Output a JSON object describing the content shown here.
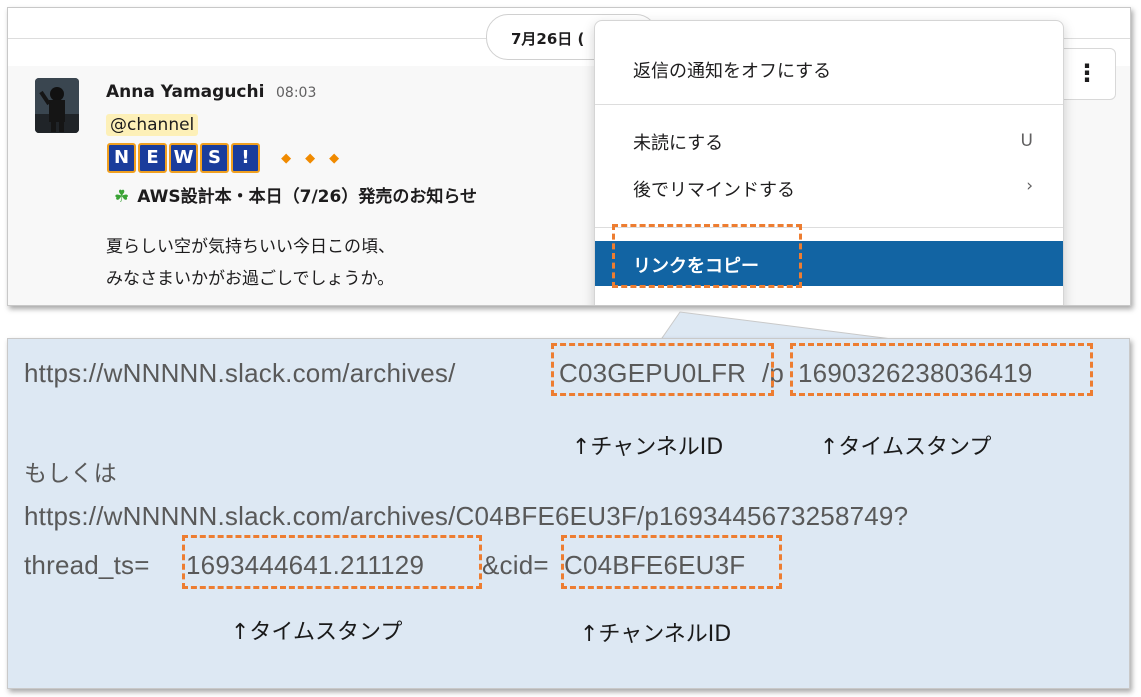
{
  "slack": {
    "date_label": "7月26日 (",
    "author": "Anna Yamaguchi",
    "time": "08:03",
    "mention": "@channel",
    "news_letters": [
      "N",
      "E",
      "W",
      "S",
      "!"
    ],
    "aws_title": "AWS設計本・本日（7/26）発売のお知らせ",
    "body_line1": "夏らしい空が気持ちいい今日この頃、",
    "body_line2": "みなさまいかがお過ごしでしょうか。",
    "more_button": "⋮",
    "icons": [
      "clover-icon",
      "more-vertical-icon",
      "chevron-right-icon"
    ]
  },
  "menu": {
    "item_notify_off": "返信の通知をオフにする",
    "item_mark_unread": "未読にする",
    "item_mark_unread_shortcut": "U",
    "item_remind_later": "後でリマインドする",
    "item_remind_later_arrow": "›",
    "item_copy_link": "リンクをコピー"
  },
  "panel": {
    "url1_prefix": "https://wNNNNN.slack.com/archives/",
    "url1_channel": "C03GEPU0LFR",
    "url1_sep": "/p",
    "url1_ts": "1690326238036419",
    "note_channel_id_1": "↑チャンネルID",
    "note_timestamp_1": "↑タイムスタンプ",
    "or_text": "もしくは",
    "url2_line1": "https://wNNNNN.slack.com/archives/C04BFE6EU3F/p1693445673258749?",
    "url2_prefix": "thread_ts=",
    "url2_ts": "1693444641.211129",
    "url2_mid": "&cid=",
    "url2_channel": "C04BFE6EU3F",
    "note_timestamp_2": "↑タイムスタンプ",
    "note_channel_id_2": "↑チャンネルID"
  },
  "colors": {
    "highlight_dash": "#ed7d31",
    "menu_active": "#1264a3",
    "panel_bg": "#dde8f3"
  }
}
